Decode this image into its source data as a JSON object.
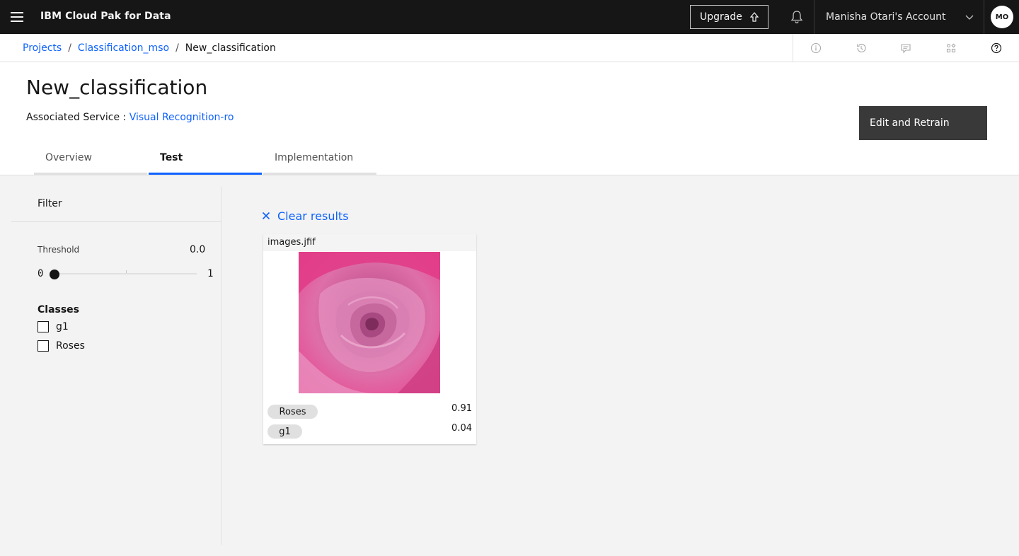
{
  "header": {
    "brand": "IBM Cloud Pak for Data",
    "upgrade_label": "Upgrade",
    "account_label": "Manisha Otari's Account",
    "avatar_initials": "MO"
  },
  "breadcrumb": {
    "items": [
      "Projects",
      "Classification_mso"
    ],
    "separator": "/",
    "current": "New_classification"
  },
  "page": {
    "title": "New_classification",
    "service_label": "Associated Service : ",
    "service_link": "Visual Recognition-ro",
    "edit_button": "Edit and Retrain",
    "tabs": [
      {
        "label": "Overview",
        "active": false
      },
      {
        "label": "Test",
        "active": true
      },
      {
        "label": "Implementation",
        "active": false
      }
    ]
  },
  "filter": {
    "title": "Filter",
    "threshold_label": "Threshold",
    "threshold_value": "0.0",
    "slider_min": "0",
    "slider_max": "1",
    "slider_level": 0,
    "classes_title": "Classes",
    "classes": [
      {
        "label": "g1",
        "checked": false
      },
      {
        "label": "Roses",
        "checked": false
      }
    ]
  },
  "results": {
    "clear_label": "Clear results",
    "cards": [
      {
        "filename": "images.jfif",
        "image": "pink-rose-photo",
        "scores": [
          {
            "class": "Roses",
            "score": "0.91"
          },
          {
            "class": "g1",
            "score": "0.04"
          }
        ]
      }
    ]
  },
  "colors": {
    "accent": "#0f62fe",
    "header_bg": "#161616",
    "rose": "#d6408a"
  }
}
